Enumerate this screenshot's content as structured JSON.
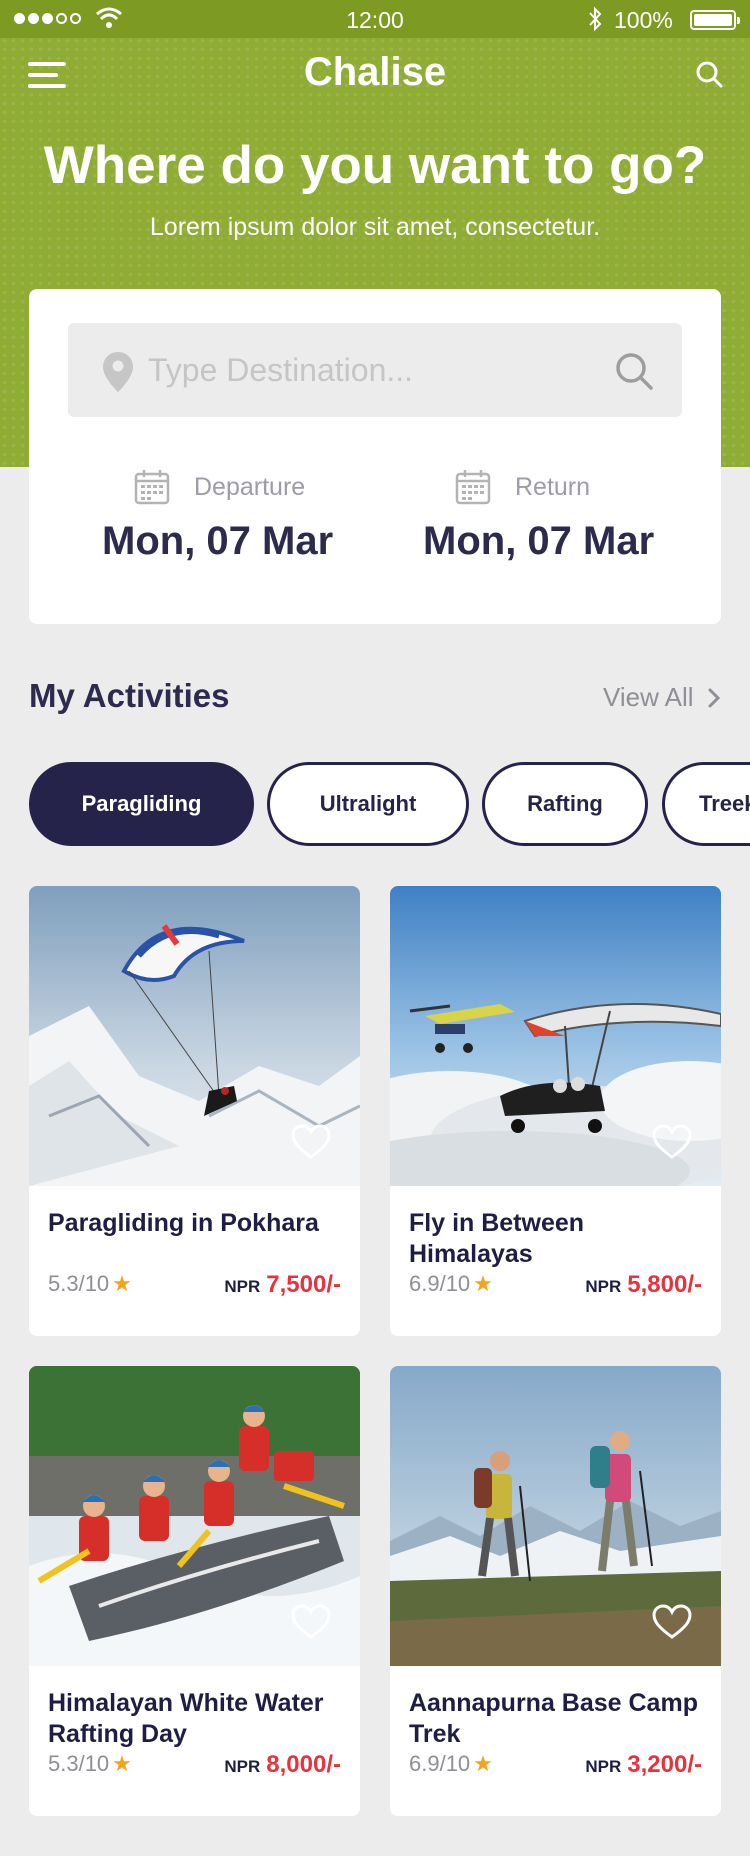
{
  "status_bar": {
    "time": "12:00",
    "battery": "100%"
  },
  "header": {
    "app_title": "Chalise",
    "headline": "Where do you want to go?",
    "subheadline": "Lorem ipsum dolor sit amet, consectetur."
  },
  "search": {
    "placeholder": "Type Destination...",
    "value": "",
    "departure_label": "Departure",
    "departure_date": "Mon, 07 Mar",
    "return_label": "Return",
    "return_date": "Mon, 07 Mar"
  },
  "activities": {
    "title": "My Activities",
    "view_all": "View All",
    "chips": [
      {
        "label": "Paragliding",
        "active": true
      },
      {
        "label": "Ultralight",
        "active": false
      },
      {
        "label": "Rafting",
        "active": false
      },
      {
        "label": "Treek",
        "active": false
      }
    ],
    "cards": [
      {
        "title": "Paragliding in Pokhara",
        "rating": "5.3/10",
        "currency": "NPR",
        "price": "7,500/-"
      },
      {
        "title": "Fly in Between Himalayas",
        "rating": "6.9/10",
        "currency": "NPR",
        "price": "5,800/-"
      },
      {
        "title": "Himalayan White Water Rafting Day",
        "rating": "5.3/10",
        "currency": "NPR",
        "price": "8,000/-"
      },
      {
        "title": "Aannapurna Base Camp Trek",
        "rating": "6.9/10",
        "currency": "NPR",
        "price": "3,200/-"
      }
    ]
  },
  "colors": {
    "header_green": "#8fac35",
    "navy": "#25234a",
    "price_red": "#e8323c",
    "star": "#f4a418"
  },
  "icons": [
    "menu-icon",
    "search-icon",
    "location-pin-icon",
    "calendar-icon",
    "chevron-right-icon",
    "heart-icon",
    "star-icon"
  ]
}
